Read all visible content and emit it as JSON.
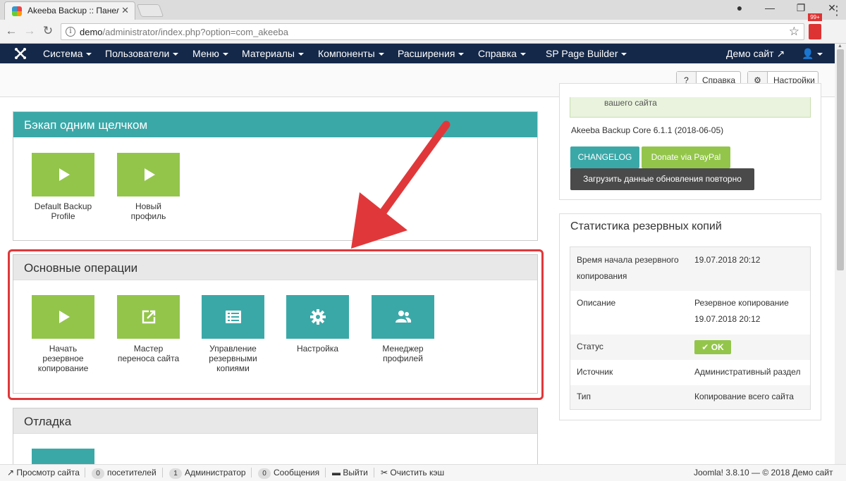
{
  "browser": {
    "tab_title": "Akeeba Backup :: Панель",
    "url_host": "demo",
    "url_path": "/administrator/index.php?option=com_akeeba",
    "extension_badge": "99+"
  },
  "adminmenu": {
    "items": [
      "Система",
      "Пользователи",
      "Меню",
      "Материалы",
      "Компоненты",
      "Расширения",
      "Справка",
      "SP Page Builder"
    ],
    "site_link": "Демо сайт"
  },
  "toolbar": {
    "help_label": "Справка",
    "settings_label": "Настройки"
  },
  "one_click": {
    "title": "Бэкап одним щелчком",
    "tiles": [
      "Default Backup Profile",
      "Новый профиль"
    ]
  },
  "basic_ops": {
    "title": "Основные операции",
    "tiles": [
      "Начать резервное копирование",
      "Мастер переноса сайта",
      "Управление резервными копиями",
      "Настройка",
      "Менеджер профилей"
    ]
  },
  "debug": {
    "title": "Отладка"
  },
  "updates": {
    "alert_text": "вашего сайта",
    "version": "Akeeba Backup Core 6.1.1 (2018-06-05)",
    "changelog_label": "CHANGELOG",
    "donate_label": "Donate via PayPal",
    "reload_label": "Загрузить данные обновления повторно"
  },
  "stats": {
    "title": "Статистика резервных копий",
    "rows": [
      {
        "key": "Время начала резервного копирования",
        "value": "19.07.2018 20:12"
      },
      {
        "key": "Описание",
        "value": "Резервное копирование 19.07.2018 20:12"
      },
      {
        "key": "Статус",
        "value": "OK"
      },
      {
        "key": "Источник",
        "value": "Административный раздел"
      },
      {
        "key": "Тип",
        "value": "Копирование всего сайта"
      }
    ]
  },
  "statusbar": {
    "view_site": "Просмотр сайта",
    "visitors_count": "0",
    "visitors_label": "посетителей",
    "admins_count": "1",
    "admins_label": "Администратор",
    "messages_count": "0",
    "messages_label": "Сообщения",
    "logout": "Выйти",
    "clear_cache": "Очистить кэш",
    "footer": "Joomla! 3.8.10 — © 2018 Демо сайт"
  },
  "colors": {
    "menu_bg": "#142849",
    "teal": "#3ba8a8",
    "green": "#93c54b",
    "highlight": "#e0383a"
  }
}
